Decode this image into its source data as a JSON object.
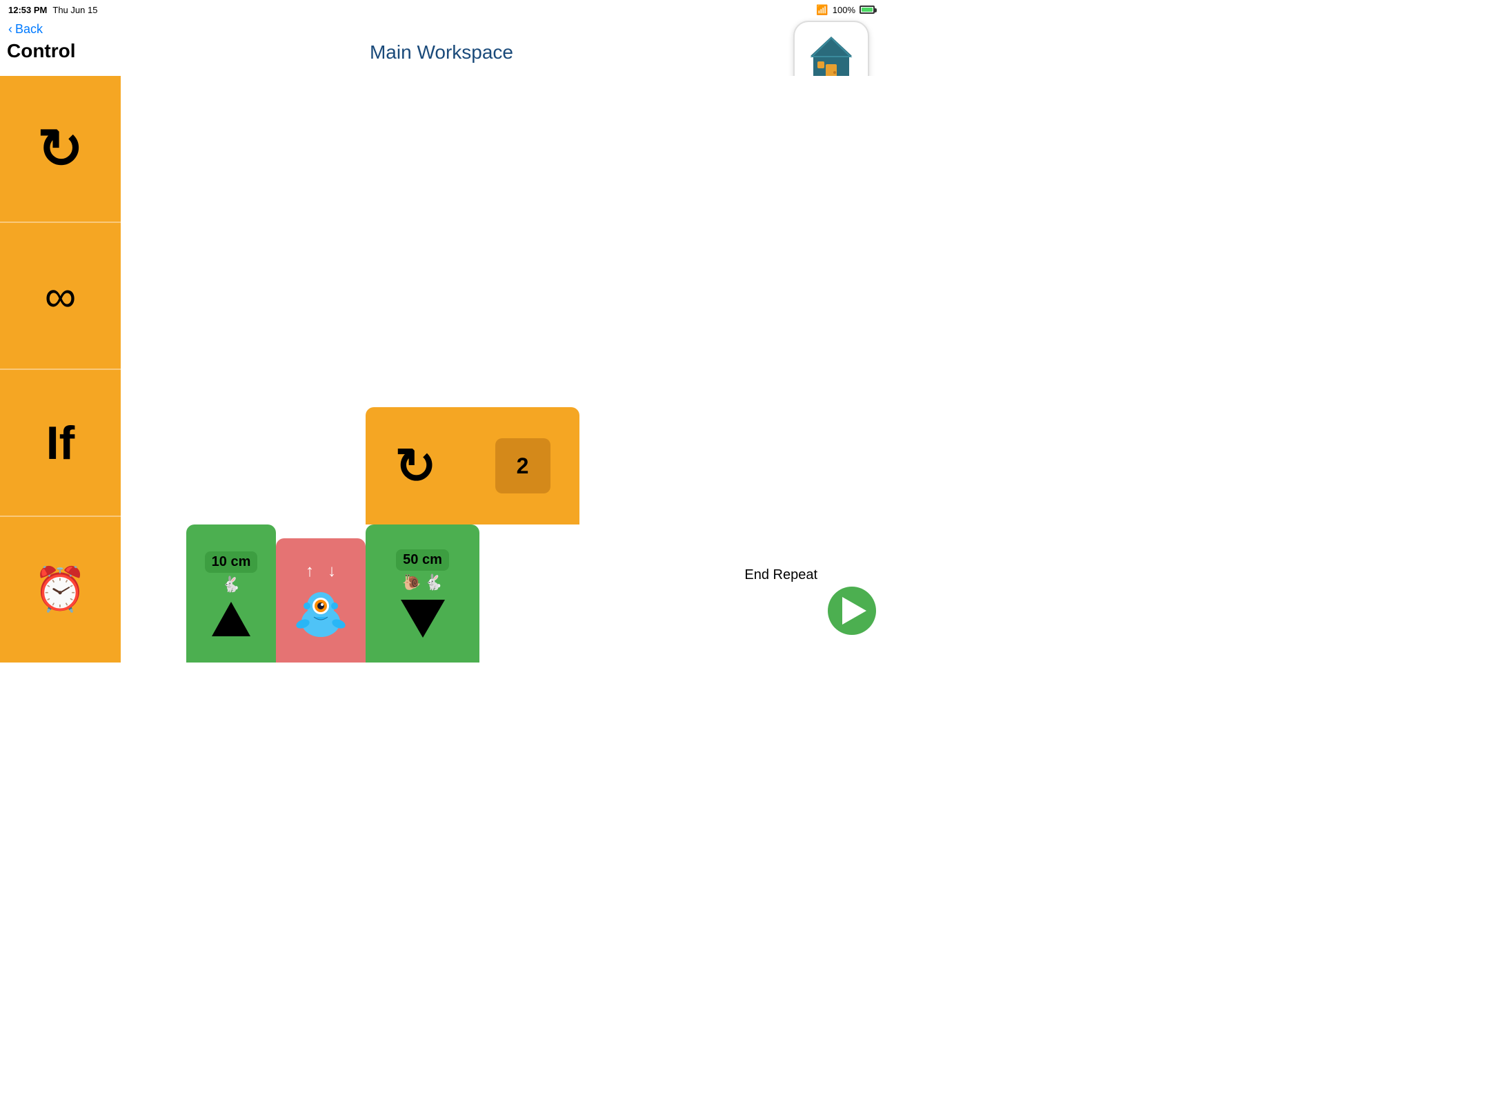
{
  "status": {
    "time": "12:53 PM",
    "date": "Thu Jun 15",
    "battery": "100%",
    "wifi": true
  },
  "nav": {
    "back_label": "Back"
  },
  "sidebar": {
    "title": "Control",
    "items": [
      {
        "id": "repeat-once",
        "icon": "↻",
        "label": "Repeat Once"
      },
      {
        "id": "repeat-infinite",
        "icon": "∞",
        "label": "Repeat Infinite"
      },
      {
        "id": "if",
        "icon": "If",
        "label": "If"
      },
      {
        "id": "timer",
        "icon": "⏰",
        "label": "Timer"
      }
    ]
  },
  "workspace": {
    "title": "Main Workspace"
  },
  "blocks": [
    {
      "id": "move-forward",
      "type": "move",
      "color": "#4caf50",
      "distance": "10 cm",
      "speed": "fast",
      "direction": "up"
    },
    {
      "id": "robot",
      "type": "robot",
      "color": "#e57373"
    },
    {
      "id": "move-backward",
      "type": "move",
      "color": "#4caf50",
      "distance": "50 cm",
      "speed": "slow",
      "direction": "down"
    },
    {
      "id": "repeat",
      "type": "repeat",
      "color": "#f5a623",
      "count": "2",
      "end_label": "End Repeat"
    }
  ],
  "play_button": {
    "label": "Play"
  }
}
